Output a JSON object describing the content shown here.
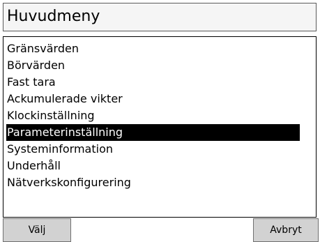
{
  "header": {
    "title": "Huvudmeny"
  },
  "menu": {
    "items": [
      {
        "label": "Gränsvärden",
        "selected": false
      },
      {
        "label": "Börvärden",
        "selected": false
      },
      {
        "label": "Fast tara",
        "selected": false
      },
      {
        "label": "Ackumulerade vikter",
        "selected": false
      },
      {
        "label": "Klockinställning",
        "selected": false
      },
      {
        "label": "Parameterinställning",
        "selected": true
      },
      {
        "label": "Systeminformation",
        "selected": false
      },
      {
        "label": "Underhåll",
        "selected": false
      },
      {
        "label": "Nätverkskonfigurering",
        "selected": false
      }
    ]
  },
  "softkeys": {
    "left_label": "Välj",
    "right_label": "Avbryt"
  },
  "colors": {
    "selection_background": "#000000",
    "selection_text": "#ffffff",
    "softkey_background": "#d2d2d2"
  }
}
